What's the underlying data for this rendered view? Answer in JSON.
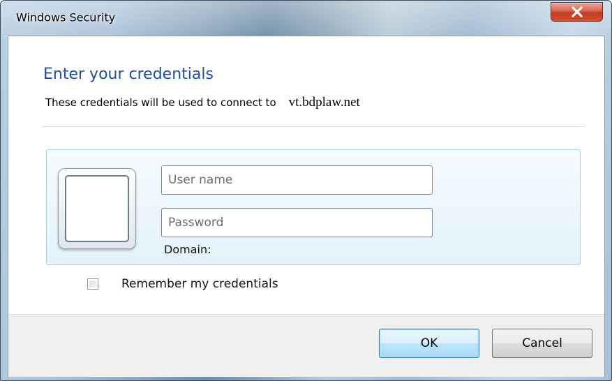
{
  "window": {
    "title": "Windows Security",
    "close_icon": "close-icon"
  },
  "dialog": {
    "heading": "Enter your credentials",
    "description": "These credentials will be used to connect to",
    "host": "vt.bdplaw.net"
  },
  "credentials": {
    "user_tile_icon": "user-tile-icon",
    "username": {
      "value": "",
      "placeholder": "User name"
    },
    "password": {
      "value": "",
      "placeholder": "Password"
    },
    "domain_label": "Domain:"
  },
  "remember": {
    "label": "Remember my credentials",
    "checked": false
  },
  "buttons": {
    "ok": "OK",
    "cancel": "Cancel"
  },
  "colors": {
    "heading": "#1e4f9e",
    "panel_border": "#a9d3ea",
    "close_button": "#c43b22",
    "ok_button_border": "#3c7fb1"
  }
}
